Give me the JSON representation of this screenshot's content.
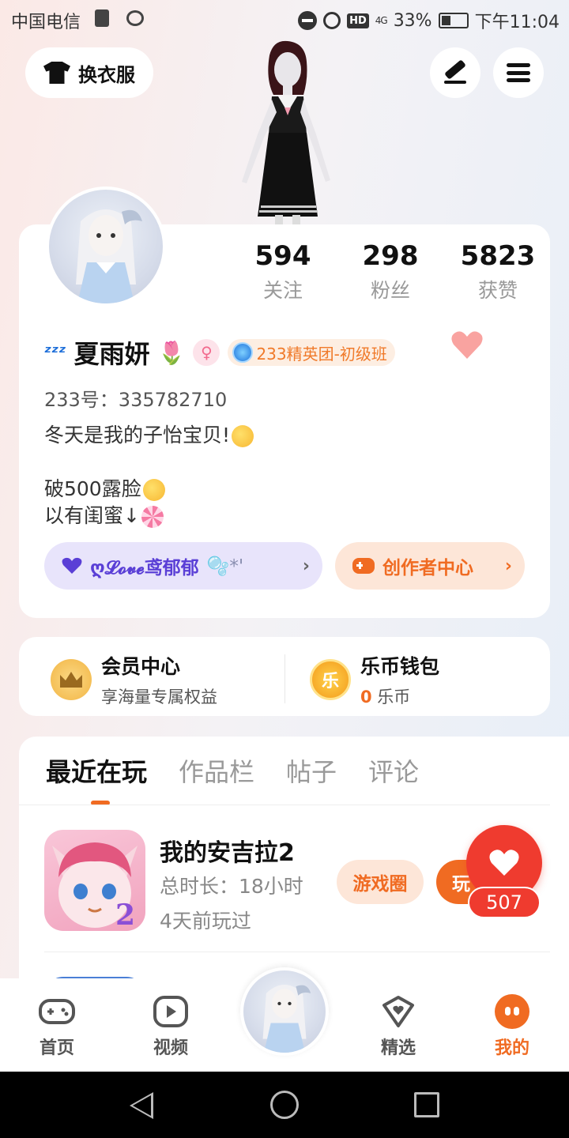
{
  "status_bar": {
    "carrier": "中国电信",
    "battery": "33%",
    "time": "下午11:04",
    "network": "4G",
    "hd": "HD"
  },
  "top": {
    "outfit_label": "换衣服"
  },
  "profile": {
    "stats": [
      {
        "value": "594",
        "label": "关注"
      },
      {
        "value": "298",
        "label": "粉丝"
      },
      {
        "value": "5823",
        "label": "获赞"
      }
    ],
    "name_prefix": "ᶻᶻᶻ",
    "name": "夏雨妍",
    "tulip": "🌷",
    "gender_symbol": "♀",
    "group_badge": "233精英团-初级班",
    "id_line": "233号：335782710",
    "bio_lines": [
      "冬天是我的子怡宝贝!",
      "",
      "破500露脸",
      "以有闺蜜↓"
    ],
    "love_chip": "ღ𝓛𝓸𝓿𝓮鸢郁郁",
    "love_chip_suffix": "🫧*'",
    "creator_chip": "创作者中心"
  },
  "wallet": {
    "vip_title": "会员中心",
    "vip_sub": "享海量专属权益",
    "coin_glyph": "乐",
    "coin_title": "乐币钱包",
    "coin_amount": "0",
    "coin_unit": " 乐币"
  },
  "tabs": [
    "最近在玩",
    "作品栏",
    "帖子",
    "评论"
  ],
  "games": [
    {
      "title": "我的安吉拉2",
      "duration": "总时长：18小时",
      "last_played": "4天前玩过",
      "circle_label": "游戏圈",
      "play_label": "玩",
      "icon_badge": "2"
    }
  ],
  "like_count": "507",
  "bottom_nav": [
    {
      "label": "首页",
      "icon": "gamepad-icon"
    },
    {
      "label": "视频",
      "icon": "play-icon"
    },
    {
      "label": "精选",
      "icon": "heart-shield-icon"
    },
    {
      "label": "我的",
      "icon": "face-icon"
    }
  ],
  "colors": {
    "accent": "#f06b22",
    "like_red": "#ef3b2f",
    "love_purple": "#5a3fd6"
  }
}
